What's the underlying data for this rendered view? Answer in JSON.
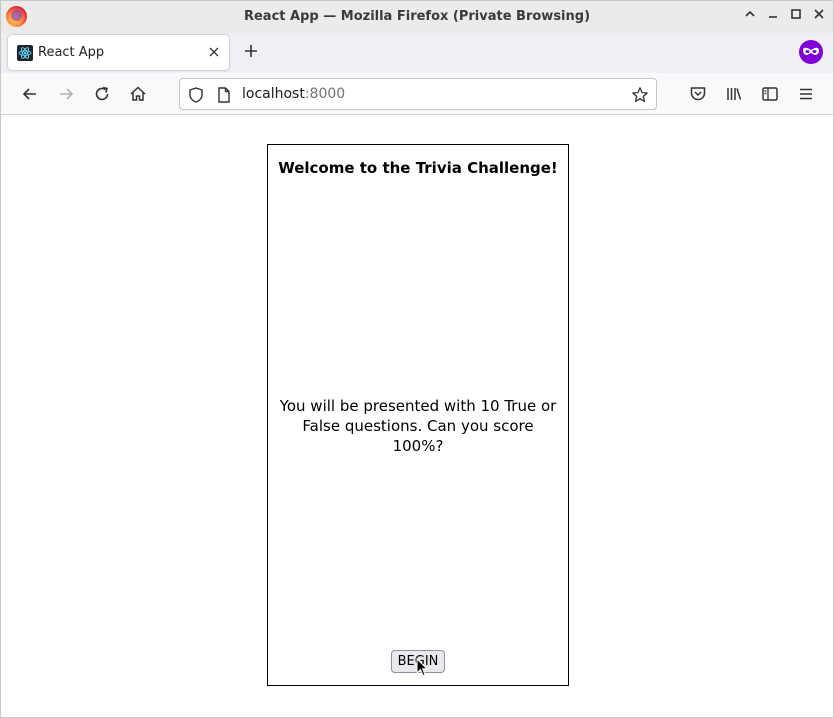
{
  "window": {
    "title": "React App — Mozilla Firefox (Private Browsing)"
  },
  "tabs": [
    {
      "label": "React App",
      "active": true
    }
  ],
  "toolbar": {
    "url_host": "localhost",
    "url_port": ":8000"
  },
  "page": {
    "heading": "Welcome to the Trivia Challenge!",
    "intro": "You will be presented with 10 True or False questions. Can you score 100%?",
    "begin_label": "BEGIN"
  },
  "colors": {
    "private_accent": "#8000d7",
    "titlebar_bg": "#ebebeb",
    "tabbar_bg": "#f0f0f4"
  },
  "icons": [
    "firefox-logo-icon",
    "react-favicon-icon",
    "close-icon",
    "plus-icon",
    "private-browsing-icon",
    "back-arrow-icon",
    "forward-arrow-icon",
    "reload-icon",
    "home-icon",
    "shield-icon",
    "page-icon",
    "bookmark-star-icon",
    "pocket-icon",
    "library-icon",
    "sidebar-icon",
    "menu-icon",
    "minimize-icon",
    "maximize-icon",
    "chevron-up-icon",
    "cursor-icon"
  ]
}
